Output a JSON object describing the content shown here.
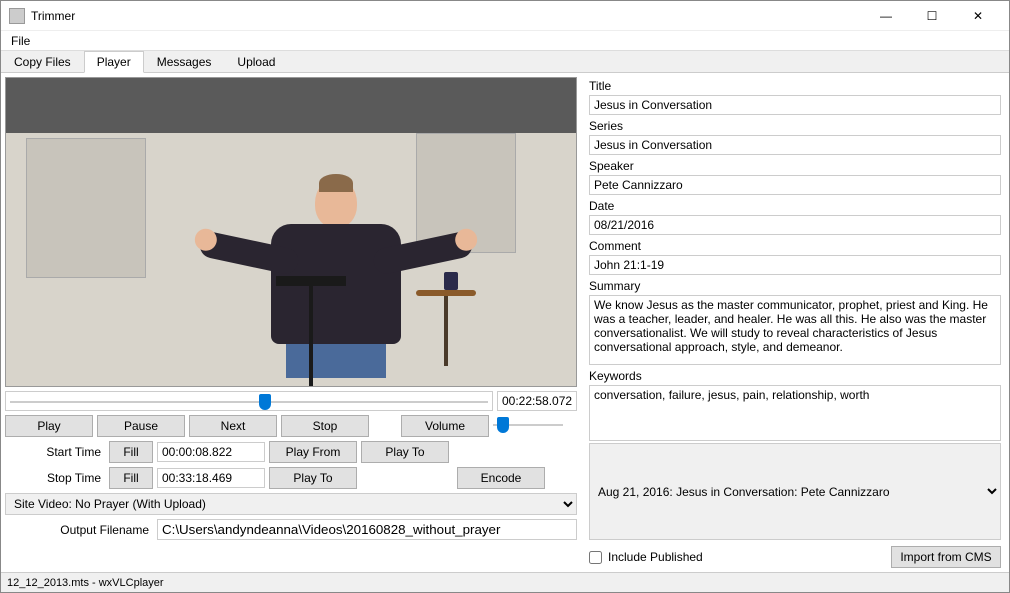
{
  "window": {
    "title": "Trimmer"
  },
  "menubar": {
    "file": "File"
  },
  "tabs": [
    {
      "label": "Copy Files",
      "active": false
    },
    {
      "label": "Player",
      "active": true
    },
    {
      "label": "Messages",
      "active": false
    },
    {
      "label": "Upload",
      "active": false
    }
  ],
  "player": {
    "timecode": "00:22:58.072",
    "seek_percent": 52,
    "buttons": {
      "play": "Play",
      "pause": "Pause",
      "next": "Next",
      "stop": "Stop",
      "volume": "Volume"
    },
    "start_time_label": "Start Time",
    "stop_time_label": "Stop Time",
    "fill": "Fill",
    "start_time": "00:00:08.822",
    "stop_time": "00:33:18.469",
    "play_from": "Play From",
    "play_to": "Play To",
    "encode": "Encode",
    "site_video": "Site Video: No Prayer (With Upload)",
    "output_filename_label": "Output Filename",
    "output_filename": "C:\\Users\\andyndeanna\\Videos\\20160828_without_prayer"
  },
  "meta": {
    "title_label": "Title",
    "title": "Jesus in Conversation",
    "series_label": "Series",
    "series": "Jesus in Conversation",
    "speaker_label": "Speaker",
    "speaker": "Pete Cannizzaro",
    "date_label": "Date",
    "date": "08/21/2016",
    "comment_label": "Comment",
    "comment": "John 21:1-19",
    "summary_label": "Summary",
    "summary": "We know Jesus as the master communicator, prophet, priest and King. He was a teacher, leader, and healer. He was all this. He also was the master conversationalist. We will study to reveal characteristics of Jesus conversational approach, style, and demeanor.",
    "keywords_label": "Keywords",
    "keywords": "conversation, failure, jesus, pain, relationship, worth",
    "cms_item": "Aug 21, 2016: Jesus in Conversation: Pete Cannizzaro",
    "include_published": "Include Published",
    "import_cms": "Import from CMS"
  },
  "statusbar": "12_12_2013.mts - wxVLCplayer"
}
